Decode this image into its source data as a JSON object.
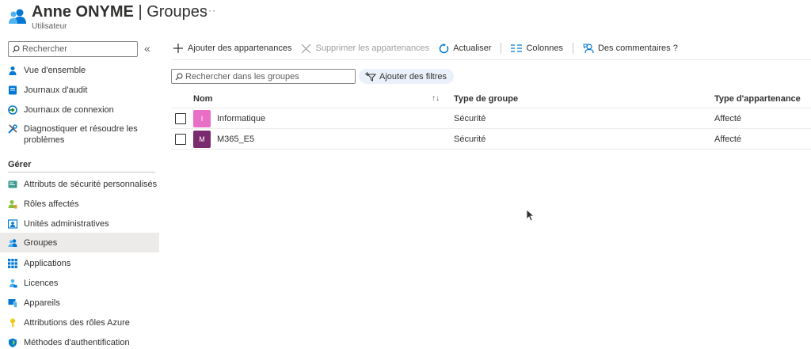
{
  "header": {
    "name": "Anne ONYME",
    "separator": " | ",
    "section": "Groupes",
    "subtitle": "Utilisateur",
    "more": "···",
    "icon": "users-icon"
  },
  "sidebar": {
    "search_placeholder": "Rechercher",
    "collapse": "«",
    "section_title": "Gérer",
    "items": [
      {
        "label": "Vue d'ensemble",
        "icon": "person-icon"
      },
      {
        "label": "Journaux d'audit",
        "icon": "audit-log-icon"
      },
      {
        "label": "Journaux de connexion",
        "icon": "sign-in-log-icon"
      },
      {
        "label": "Diagnostiquer et résoudre les problèmes",
        "icon": "wrench-icon"
      },
      {
        "label": "Attributs de sécurité personnalisés",
        "icon": "security-attributes-icon"
      },
      {
        "label": "Rôles affectés",
        "icon": "roles-icon"
      },
      {
        "label": "Unités administratives",
        "icon": "admin-units-icon"
      },
      {
        "label": "Groupes",
        "icon": "groups-icon",
        "active": true
      },
      {
        "label": "Applications",
        "icon": "grid-icon"
      },
      {
        "label": "Licences",
        "icon": "license-icon"
      },
      {
        "label": "Appareils",
        "icon": "devices-icon"
      },
      {
        "label": "Attributions des rôles Azure",
        "icon": "key-icon"
      },
      {
        "label": "Méthodes d'authentification",
        "icon": "shield-icon"
      }
    ]
  },
  "toolbar": {
    "add": "Ajouter des appartenances",
    "remove": "Supprimer les appartenances",
    "refresh": "Actualiser",
    "columns": "Colonnes",
    "feedback": "Des commentaires ?"
  },
  "filters": {
    "search_placeholder": "Rechercher dans les groupes",
    "add_filter": "Ajouter des filtres"
  },
  "table": {
    "headers": {
      "name": "Nom",
      "type": "Type de groupe",
      "membership": "Type d'appartenance"
    },
    "sort_indicator": "↑↓",
    "rows": [
      {
        "initial": "I",
        "name": "Informatique",
        "type": "Sécurité",
        "membership": "Affecté",
        "color": "#e86fc5"
      },
      {
        "initial": "M",
        "name": "M365_E5",
        "type": "Sécurité",
        "membership": "Affecté",
        "color": "#7a2a6e"
      }
    ]
  },
  "colors": {
    "accent": "#0078d4",
    "active_bg": "#edebe9",
    "pill_bg": "#eaf1fb"
  }
}
